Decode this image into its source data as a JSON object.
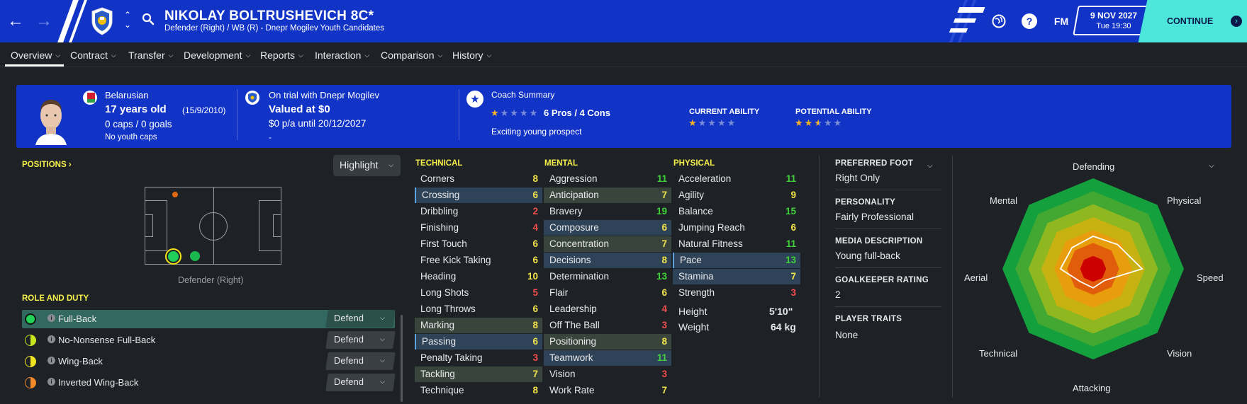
{
  "header": {
    "player_name": "NIKOLAY BOLTRUSHEVICH 8C*",
    "subtitle": "Defender (Right) / WB (R) - Dnepr Mogilev Youth Candidates",
    "fm_label": "FM",
    "date": "9 NOV 2027",
    "time": "Tue 19:30",
    "continue_label": "CONTINUE",
    "brand_color": "#1133c6",
    "accent_color": "#4de6db"
  },
  "tabs": [
    {
      "label": "Overview"
    },
    {
      "label": "Contract"
    },
    {
      "label": "Transfer"
    },
    {
      "label": "Development"
    },
    {
      "label": "Reports"
    },
    {
      "label": "Interaction"
    },
    {
      "label": "Comparison"
    },
    {
      "label": "History"
    }
  ],
  "summary": {
    "nationality": "Belarusian",
    "age": "17 years old",
    "dob": "(15/9/2010)",
    "caps": "0 caps / 0 goals",
    "youth_caps": "No youth caps",
    "club_status": "On trial with Dnepr Mogilev",
    "value": "Valued at $0",
    "wage": "$0 p/a until 20/12/2027",
    "wage_extra": "-",
    "coach_summary_title": "Coach Summary",
    "pros_cons": "6 Pros / 4 Cons",
    "coach_rating_stars": 1,
    "coach_comment": "Exciting young prospect",
    "current_ability_label": "CURRENT ABILITY",
    "current_ability_stars": 1,
    "potential_ability_label": "POTENTIAL ABILITY",
    "potential_ability_stars": 2.5
  },
  "positions": {
    "title": "POSITIONS",
    "highlight_label": "Highlight",
    "position_label": "Defender (Right)"
  },
  "roles": {
    "title": "ROLE AND DUTY",
    "items": [
      {
        "name": "Full-Back",
        "duty": "Defend",
        "suitability_color": "#22d357"
      },
      {
        "name": "No-Nonsense Full-Back",
        "duty": "Defend",
        "suitability_color": "#c8e41a"
      },
      {
        "name": "Wing-Back",
        "duty": "Defend",
        "suitability_color": "#f0e420"
      },
      {
        "name": "Inverted Wing-Back",
        "duty": "Defend",
        "suitability_color": "#f08a2a"
      }
    ]
  },
  "attributes": {
    "technical_title": "TECHNICAL",
    "mental_title": "MENTAL",
    "physical_title": "PHYSICAL",
    "technical": [
      {
        "name": "Corners",
        "value": "8"
      },
      {
        "name": "Crossing",
        "value": "6"
      },
      {
        "name": "Dribbling",
        "value": "2"
      },
      {
        "name": "Finishing",
        "value": "4"
      },
      {
        "name": "First Touch",
        "value": "6"
      },
      {
        "name": "Free Kick Taking",
        "value": "6"
      },
      {
        "name": "Heading",
        "value": "10"
      },
      {
        "name": "Long Shots",
        "value": "5"
      },
      {
        "name": "Long Throws",
        "value": "6"
      },
      {
        "name": "Marking",
        "value": "8"
      },
      {
        "name": "Passing",
        "value": "6"
      },
      {
        "name": "Penalty Taking",
        "value": "3"
      },
      {
        "name": "Tackling",
        "value": "7"
      },
      {
        "name": "Technique",
        "value": "8"
      }
    ],
    "mental": [
      {
        "name": "Aggression",
        "value": "11"
      },
      {
        "name": "Anticipation",
        "value": "7"
      },
      {
        "name": "Bravery",
        "value": "19"
      },
      {
        "name": "Composure",
        "value": "6"
      },
      {
        "name": "Concentration",
        "value": "7"
      },
      {
        "name": "Decisions",
        "value": "8"
      },
      {
        "name": "Determination",
        "value": "13"
      },
      {
        "name": "Flair",
        "value": "6"
      },
      {
        "name": "Leadership",
        "value": "4"
      },
      {
        "name": "Off The Ball",
        "value": "3"
      },
      {
        "name": "Positioning",
        "value": "8"
      },
      {
        "name": "Teamwork",
        "value": "11"
      },
      {
        "name": "Vision",
        "value": "3"
      },
      {
        "name": "Work Rate",
        "value": "7"
      }
    ],
    "physical": [
      {
        "name": "Acceleration",
        "value": "11"
      },
      {
        "name": "Agility",
        "value": "9"
      },
      {
        "name": "Balance",
        "value": "15"
      },
      {
        "name": "Jumping Reach",
        "value": "6"
      },
      {
        "name": "Natural Fitness",
        "value": "11"
      },
      {
        "name": "Pace",
        "value": "13"
      },
      {
        "name": "Stamina",
        "value": "7"
      },
      {
        "name": "Strength",
        "value": "3"
      }
    ],
    "height_label": "Height",
    "height_value": "5'10\"",
    "weight_label": "Weight",
    "weight_value": "64 kg"
  },
  "info": {
    "preferred_foot_title": "PREFERRED FOOT",
    "preferred_foot": "Right Only",
    "personality_title": "PERSONALITY",
    "personality": "Fairly Professional",
    "media_title": "MEDIA DESCRIPTION",
    "media": "Young full-back",
    "gk_title": "GOALKEEPER RATING",
    "gk_rating": "2",
    "traits_title": "PLAYER TRAITS",
    "traits": "None"
  },
  "radar": {
    "labels": [
      "Defending",
      "Physical",
      "Speed",
      "Vision",
      "Attacking",
      "Technical",
      "Aerial",
      "Mental"
    ],
    "values": [
      0.36,
      0.38,
      0.54,
      0.18,
      0.21,
      0.2,
      0.36,
      0.33
    ],
    "band_colors": [
      "#cc0000",
      "#e15d0b",
      "#e89e0c",
      "#c7b212",
      "#8fb820",
      "#42a832",
      "#14a03c"
    ]
  }
}
